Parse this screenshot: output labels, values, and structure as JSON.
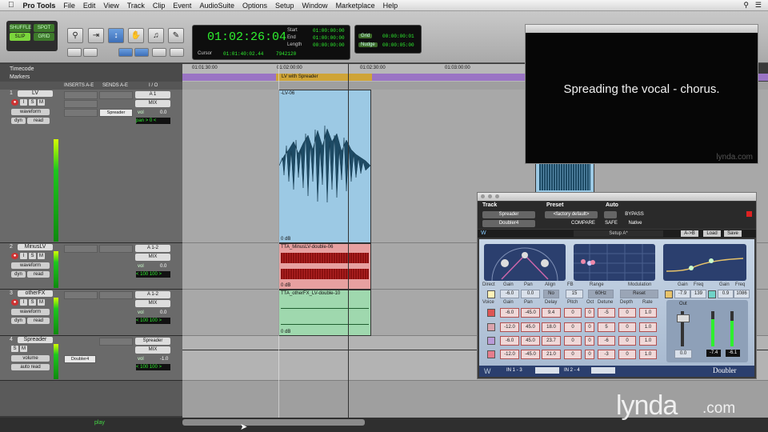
{
  "menubar": {
    "app": "Pro Tools",
    "items": [
      "File",
      "Edit",
      "View",
      "Track",
      "Clip",
      "Event",
      "AudioSuite",
      "Options",
      "Setup",
      "Window",
      "Marketplace",
      "Help"
    ]
  },
  "toolbar": {
    "modes": [
      "SHUFFLE",
      "SPOT",
      "SLIP",
      "GRID"
    ],
    "counter_main": "01:02:26:04",
    "start_label": "Start",
    "end_label": "End",
    "length_label": "Length",
    "start": "01:00:00:00",
    "end": "01:00:00:00",
    "length": "00:00:00:00",
    "cursor_label": "Cursor",
    "cursor": "01:01:40:02.44",
    "samples": "7942120",
    "grid_label": "Grid",
    "grid": "00:00:00:01",
    "nudge_label": "Nudge",
    "nudge": "00:00:05:00"
  },
  "video": {
    "caption": "Spreading the vocal - chorus.",
    "watermark": "lynda.com"
  },
  "rulers": {
    "timecode": "Timecode",
    "markers": "Markers"
  },
  "columns": {
    "inserts": "INSERTS A-E",
    "sends": "SENDS A-E",
    "io": "I / O"
  },
  "timeline_ticks": [
    "01:01:30:00",
    "01:02:00:00",
    "01:02:30:00",
    "01:03:00:00"
  ],
  "marker_label": "LV with Spreader",
  "tracks": [
    {
      "num": "1",
      "name": "LV",
      "view": "waveform",
      "auto": "read",
      "dyn": "dyn",
      "io": "A 1",
      "out": "MIX",
      "send": "Spreader",
      "vol_label": "vol",
      "vol": "0.0",
      "pan_label": "pan",
      "pan": "> 0 <"
    },
    {
      "num": "2",
      "name": "MinusLV",
      "view": "waveform",
      "auto": "read",
      "dyn": "dyn",
      "io": "A 1-2",
      "out": "MIX",
      "vol_label": "vol",
      "vol": "0.0",
      "pan": "< 100   100 >"
    },
    {
      "num": "3",
      "name": "otherFX",
      "view": "waveform",
      "auto": "read",
      "dyn": "dyn",
      "io": "A 1-2",
      "out": "MIX",
      "vol_label": "vol",
      "vol": "0.0",
      "pan": "< 100   100 >"
    },
    {
      "num": "4",
      "name": "Spreader",
      "view": "volume",
      "auto": "auto read",
      "io": "Spreader",
      "out": "MIX",
      "insert": "Doubler4",
      "vol_label": "vol",
      "vol": "-1.0",
      "pan": "< 100   100 >"
    }
  ],
  "clips": [
    {
      "name": "-LV-06",
      "db": "0 dB"
    },
    {
      "name": "TTA_MinusLV-double-06",
      "db": "0 dB"
    },
    {
      "name": "TTA_otherFX_LV-double-10",
      "db": "0 dB"
    }
  ],
  "plugin": {
    "track_label": "Track",
    "preset_label": "Preset",
    "auto_label": "Auto",
    "track": "Spreader",
    "insert": "Doubler4",
    "preset": "<factory default>",
    "compare": "COMPARE",
    "bypass": "BYPASS",
    "safe": "SAFE",
    "native": "Native",
    "setup": "Setup A*",
    "ab": "A->B",
    "load": "Load",
    "save": "Save",
    "direct_row": {
      "labels": [
        "Direct",
        "Gain",
        "Pan",
        "Align",
        "FB",
        "Range",
        "Modulation"
      ],
      "values": [
        "-6.0",
        "0.0",
        "No",
        "15",
        "60Hz",
        "Reset"
      ]
    },
    "right_labels": [
      "Gain",
      "Freq",
      "Gain",
      "Freq"
    ],
    "right_values": [
      "-7.9",
      "139",
      "0.9",
      "1086"
    ],
    "voice_header": [
      "Voice",
      "Gain",
      "Pan",
      "Delay",
      "Pitch",
      "Oct",
      "Detune",
      "Depth",
      "Rate"
    ],
    "voices": [
      [
        "-6.0",
        "-45.0",
        "9.4",
        "0",
        "0",
        "-5",
        "0",
        "1.0"
      ],
      [
        "-12.0",
        "45.0",
        "18.0",
        "0",
        "0",
        "5",
        "0",
        "1.0"
      ],
      [
        "-6.0",
        "45.0",
        "23.7",
        "0",
        "0",
        "-6",
        "0",
        "1.0"
      ],
      [
        "-12.0",
        "-45.0",
        "21.0",
        "0",
        "0",
        "-3",
        "0",
        "1.0"
      ]
    ],
    "out_label": "Out",
    "out_values": [
      "0.0",
      "-7.4",
      "-6.1"
    ],
    "io_left": "IN 1 - 3",
    "io_right": "IN 2 - 4",
    "brand": "Doubler"
  },
  "transport": {
    "status": "play"
  },
  "branding": {
    "lynda": "lynda",
    "com": ".com"
  }
}
